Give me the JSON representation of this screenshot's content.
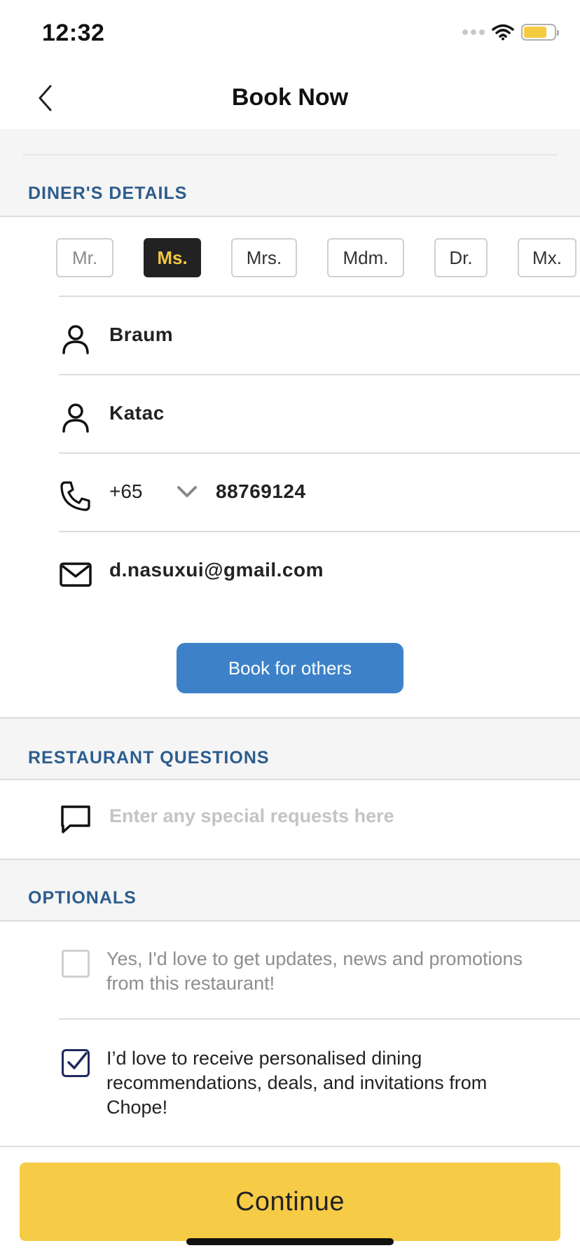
{
  "status_bar": {
    "time": "12:32",
    "icons": [
      "signal-dots-icon",
      "wifi-icon",
      "battery-icon"
    ],
    "battery_color": "#f5cb42"
  },
  "nav": {
    "back_icon": "chevron-left-icon",
    "title": "Book Now"
  },
  "diners_details": {
    "section_label": "DINER'S DETAILS",
    "salutations": [
      {
        "label": "Mr.",
        "state": "muted"
      },
      {
        "label": "Ms.",
        "state": "selected"
      },
      {
        "label": "Mrs.",
        "state": "normal"
      },
      {
        "label": "Mdm.",
        "state": "normal"
      },
      {
        "label": "Dr.",
        "state": "normal"
      },
      {
        "label": "Mx.",
        "state": "normal"
      }
    ],
    "first_name": {
      "icon": "person-icon",
      "value": "Braum"
    },
    "last_name": {
      "icon": "person-icon",
      "value": "Katac"
    },
    "phone": {
      "icon": "phone-icon",
      "country_code": "+65",
      "dropdown_icon": "chevron-down-icon",
      "number": "88769124"
    },
    "email": {
      "icon": "mail-icon",
      "value": "d.nasuxui@gmail.com"
    },
    "book_for_others_label": "Book for others"
  },
  "restaurant_questions": {
    "section_label": "RESTAURANT QUESTIONS",
    "icon": "chat-bubble-icon",
    "placeholder": "Enter any special requests here",
    "value": ""
  },
  "optionals": {
    "section_label": "OPTIONALS",
    "items": [
      {
        "text": "Yes, I'd love to get updates, news and promotions from this restaurant!",
        "checked": false
      },
      {
        "text": "I’d love to receive personalised dining recommendations, deals, and invitations from Chope!",
        "checked": true
      }
    ]
  },
  "footer": {
    "continue_label": "Continue"
  },
  "colors": {
    "accent_blue": "#3d82c9",
    "section_label": "#2d5d8d",
    "continue_yellow": "#f6cb46",
    "selected_bg": "#222222",
    "selected_text": "#f5c63f"
  }
}
